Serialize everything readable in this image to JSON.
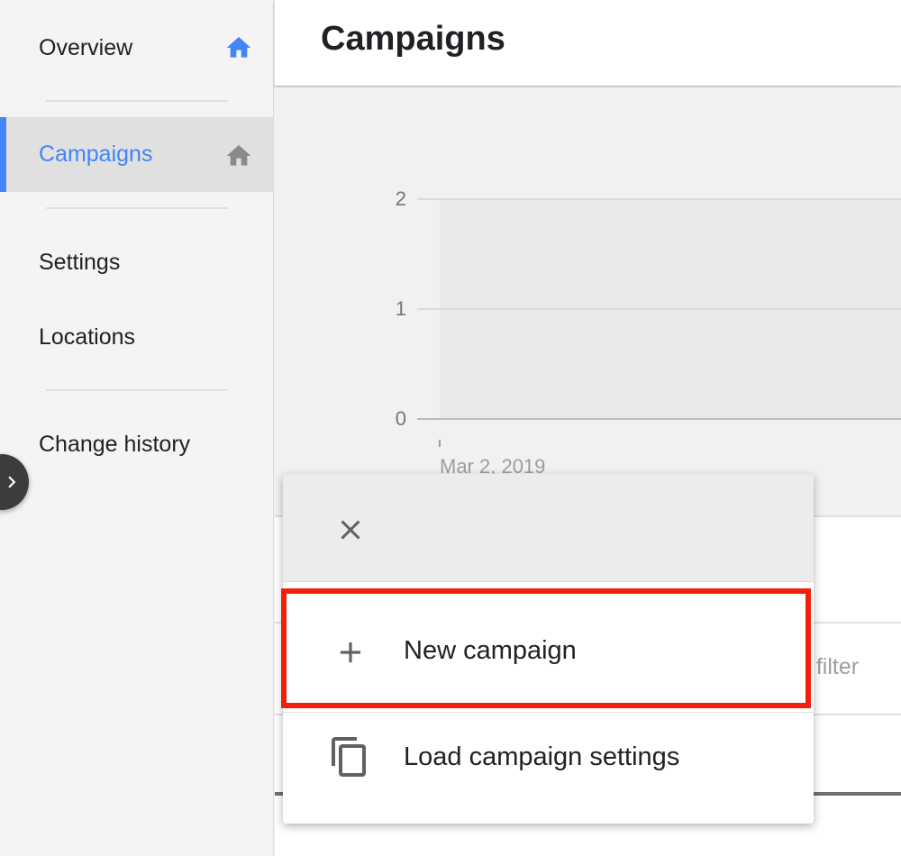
{
  "sidebar": {
    "items": [
      {
        "label": "Overview",
        "icon": "home-icon",
        "active": false
      },
      {
        "label": "Campaigns",
        "icon": "home-icon",
        "active": true
      },
      {
        "label": "Settings"
      },
      {
        "label": "Locations"
      },
      {
        "label": "Change history"
      }
    ],
    "expand_icon": "chevron-right-icon"
  },
  "header": {
    "title": "Campaigns"
  },
  "chart_data": {
    "type": "line",
    "title": "",
    "xlabel": "",
    "ylabel": "",
    "y_ticks": [
      "2",
      "1",
      "0"
    ],
    "x_ticks": [
      "Mar 2, 2019"
    ],
    "ylim": [
      0,
      2
    ],
    "series": []
  },
  "table": {
    "filter_text": "d filter"
  },
  "menu": {
    "close_icon": "close-icon",
    "items": [
      {
        "label": "New campaign",
        "icon": "plus-icon",
        "highlighted": true
      },
      {
        "label": "Load campaign settings",
        "icon": "copy-icon"
      }
    ]
  },
  "colors": {
    "accent": "#4285f4",
    "highlight": "#f2200a",
    "sidebar_bg": "#f4f4f4",
    "active_bg": "#e0e0e0"
  }
}
